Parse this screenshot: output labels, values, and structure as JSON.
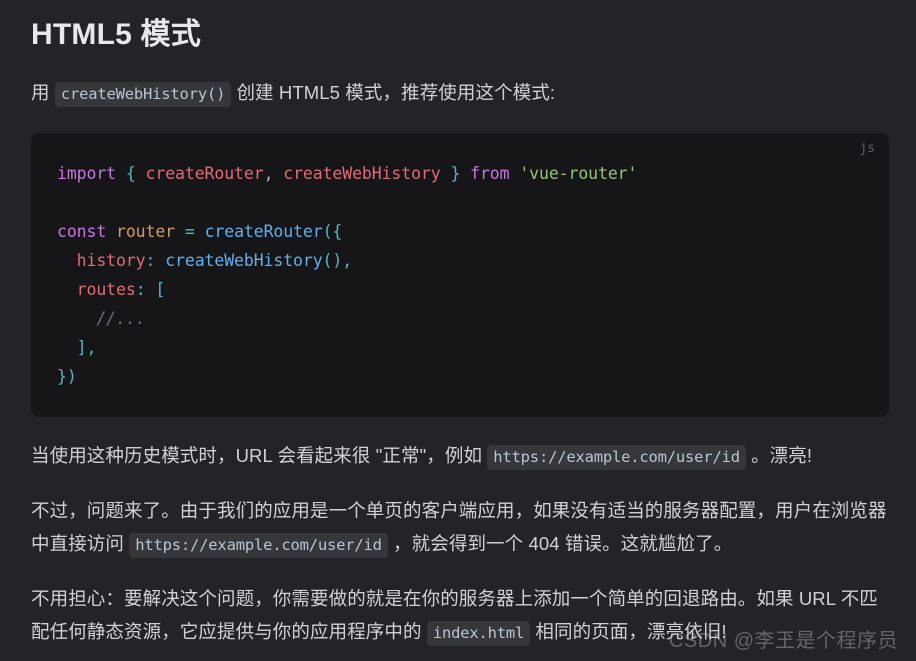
{
  "page": {
    "title": "HTML5 模式"
  },
  "intro": {
    "before": "用 ",
    "code": "createWebHistory()",
    "after": " 创建 HTML5 模式，推荐使用这个模式:"
  },
  "code_block": {
    "language_label": "js",
    "lines": [
      "import { createRouter, createWebHistory } from 'vue-router'",
      "",
      "const router = createRouter({",
      "  history: createWebHistory(),",
      "  routes: [",
      "    //...",
      "  ],",
      "})"
    ],
    "tokens": {
      "import": "import",
      "brace_open": "{",
      "createRouter": "createRouter",
      "comma": ",",
      "createWebHistory": "createWebHistory",
      "brace_close": "}",
      "from": "from",
      "module": "'vue-router'",
      "const": "const",
      "router": "router",
      "equals": "=",
      "call_open": "({",
      "history_key": "history",
      "colon": ":",
      "createWebHistory_call": "createWebHistory",
      "paren_pair_comma": "(),",
      "routes_key": "routes",
      "bracket_open": "[",
      "comment": "//...",
      "bracket_close_comma": "],",
      "close_all": "})"
    },
    "colors": {
      "background": "#161618",
      "keyword": "#c678dd",
      "identifier": "#e06c75",
      "variable": "#d19a66",
      "function": "#61afef",
      "punctuation": "#56b6c2",
      "string": "#98c379",
      "comment": "#6b727d"
    }
  },
  "para_normal": {
    "before": "当使用这种历史模式时，URL 会看起来很 \"正常\"，例如 ",
    "code": "https://example.com/user/id",
    "after": " 。漂亮!"
  },
  "para_problem": {
    "before": "不过，问题来了。由于我们的应用是一个单页的客户端应用，如果没有适当的服务器配置，用户在浏览器中直接访问 ",
    "code": "https://example.com/user/id",
    "after": " ，就会得到一个 404 错误。这就尴尬了。"
  },
  "para_fix": {
    "before": "不用担心：要解决这个问题，你需要做的就是在你的服务器上添加一个简单的回退路由。如果 URL 不匹配任何静态资源，它应提供与你的应用程序中的 ",
    "code": "index.html",
    "after": " 相同的页面，漂亮依旧!"
  },
  "watermark": {
    "text": "CSDN @李玊是个程序员"
  },
  "theme": {
    "page_background": "#232428",
    "text_color": "#d0d2d5",
    "heading_color": "#e6e8ea",
    "inline_code_background": "#35373b",
    "inline_code_color": "#b9c5d4"
  }
}
